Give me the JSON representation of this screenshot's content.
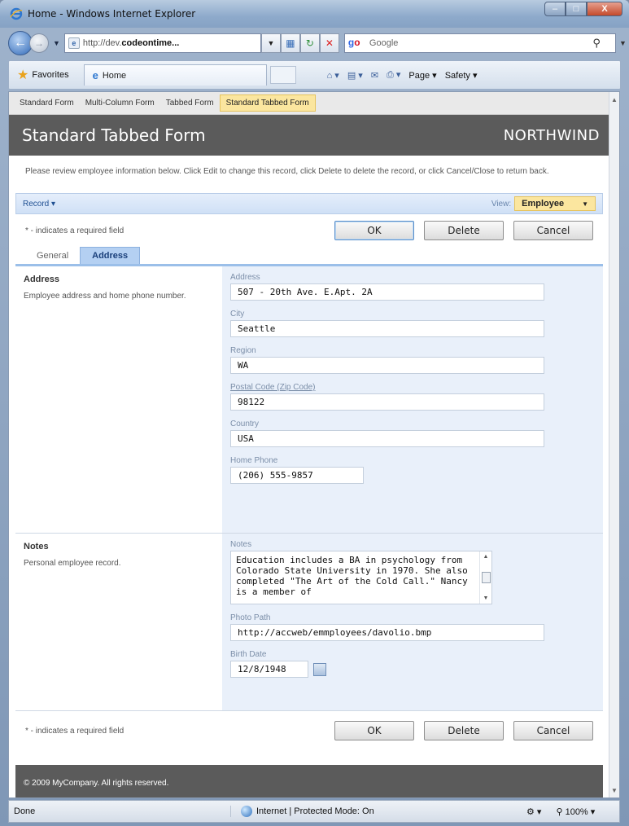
{
  "window": {
    "title": "Home - Windows Internet Explorer",
    "close_label": "X"
  },
  "browser": {
    "url_prefix": "http://dev.",
    "url_domain": "codeontime...",
    "search_placeholder": "Google",
    "favorites_label": "Favorites",
    "tab_title": "Home",
    "page_menu": "Page ▾",
    "safety_menu": "Safety ▾"
  },
  "topnav": {
    "items": [
      "Standard Form",
      "Multi-Column Form",
      "Tabbed Form",
      "Standard Tabbed Form"
    ],
    "active_index": 3
  },
  "banner": {
    "title": "Standard Tabbed Form",
    "brand": "NORTHWIND"
  },
  "description": "Please review employee information below. Click Edit to change this record, click Delete to delete the record, or click Cancel/Close to return back.",
  "actionbar": {
    "record": "Record ▾",
    "view_label": "View:",
    "view_value": "Employee"
  },
  "required_note": "* - indicates a required field",
  "buttons": {
    "ok": "OK",
    "delete": "Delete",
    "cancel": "Cancel"
  },
  "tabs": [
    "General",
    "Address"
  ],
  "selected_tab": "Address",
  "address_section": {
    "heading": "Address",
    "description": "Employee address and home phone number.",
    "fields": {
      "address": {
        "label": "Address",
        "value": "507 - 20th Ave. E.Apt. 2A"
      },
      "city": {
        "label": "City",
        "value": "Seattle"
      },
      "region": {
        "label": "Region",
        "value": "WA"
      },
      "postal": {
        "label": "Postal Code (Zip Code)",
        "value": "98122"
      },
      "country": {
        "label": "Country",
        "value": "USA"
      },
      "phone": {
        "label": "Home Phone",
        "value": "(206) 555-9857"
      }
    }
  },
  "notes_section": {
    "heading": "Notes",
    "description": "Personal employee record.",
    "fields": {
      "notes": {
        "label": "Notes",
        "value": "Education includes a BA in psychology from Colorado State University in 1970. She also completed \"The Art of the Cold Call.\" Nancy is a member of"
      },
      "photo": {
        "label": "Photo Path",
        "value": "http://accweb/emmployees/davolio.bmp"
      },
      "birth": {
        "label": "Birth Date",
        "value": "12/8/1948"
      }
    }
  },
  "footer": "© 2009 MyCompany. All rights reserved.",
  "status": {
    "done": "Done",
    "zone": "Internet | Protected Mode: On",
    "zoom": "100%"
  },
  "colors": {
    "banner": "#5b5b5b",
    "active_tab": "#fbe69f",
    "field_panel": "#e9f0fa"
  }
}
